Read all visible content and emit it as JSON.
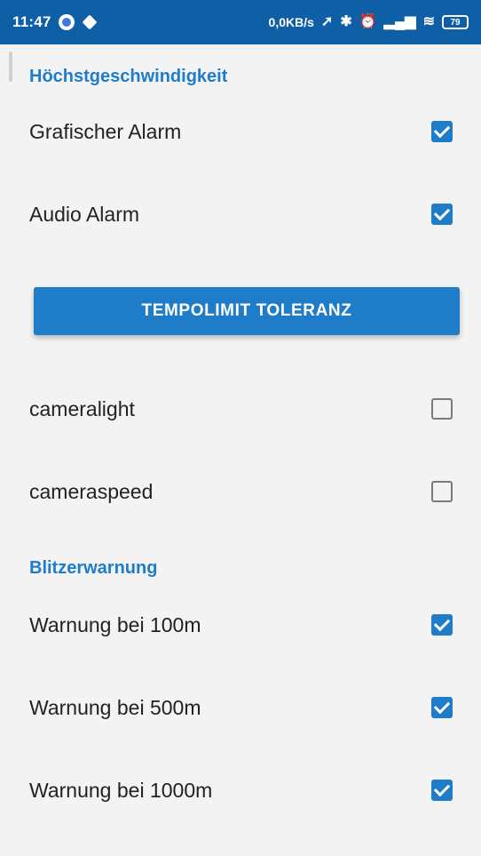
{
  "status_bar": {
    "time": "11:47",
    "net_speed": "0,0KB/s",
    "battery": "79"
  },
  "sections": {
    "hoechstgeschwindigkeit": "Höchstgeschwindigkeit",
    "blitzerwarnung": "Blitzerwarnung"
  },
  "settings": {
    "grafischer_alarm": {
      "label": "Grafischer Alarm",
      "checked": true
    },
    "audio_alarm": {
      "label": "Audio Alarm",
      "checked": true
    },
    "cameralight": {
      "label": "cameralight",
      "checked": false
    },
    "cameraspeed": {
      "label": "cameraspeed",
      "checked": false
    },
    "warnung_100": {
      "label": "Warnung bei 100m",
      "checked": true
    },
    "warnung_500": {
      "label": "Warnung bei 500m",
      "checked": true
    },
    "warnung_1000": {
      "label": "Warnung bei 1000m",
      "checked": true
    }
  },
  "buttons": {
    "tempolimit_toleranz": "TEMPOLIMIT TOLERANZ"
  },
  "colors": {
    "status_bar": "#0f5fa6",
    "accent": "#1e7cc9",
    "background": "#f3f3f3"
  }
}
